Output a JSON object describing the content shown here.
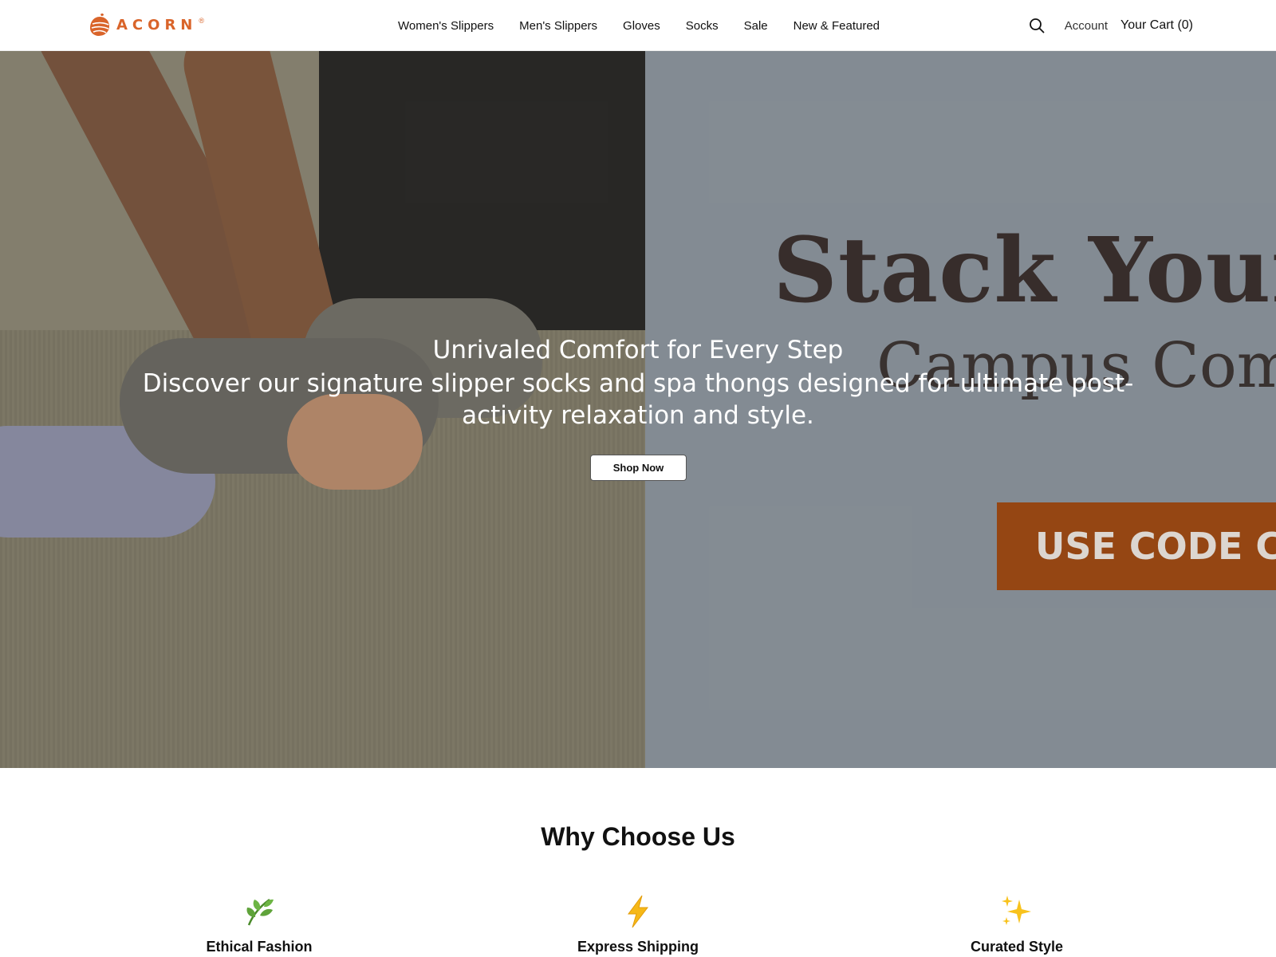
{
  "brand": {
    "name": "ACORN",
    "registered": "®",
    "color": "#d9642a"
  },
  "nav": {
    "items": [
      {
        "label": "Women's Slippers"
      },
      {
        "label": "Men's Slippers"
      },
      {
        "label": "Gloves"
      },
      {
        "label": "Socks"
      },
      {
        "label": "Sale"
      },
      {
        "label": "New & Featured"
      }
    ]
  },
  "header": {
    "search_icon": "search-icon",
    "account_label": "Account",
    "cart_label": "Your Cart (0)"
  },
  "hero": {
    "heading": "Unrivaled Comfort for Every Step",
    "subheading": "Discover our signature slipper socks and spa thongs designed for ultimate post-activity relaxation and style.",
    "cta_label": "Shop Now",
    "promo_image": {
      "title": "Stack Your",
      "subtitle": "Campus Comfo",
      "code_text": "USE CODE CA",
      "code_bg": "#9e4a15",
      "panel_bg": "#8b939b"
    }
  },
  "why": {
    "title": "Why Choose Us",
    "features": [
      {
        "icon": "🌿",
        "icon_name": "leaf-icon",
        "label": "Ethical Fashion"
      },
      {
        "icon": "⚡",
        "icon_name": "lightning-icon",
        "label": "Express Shipping"
      },
      {
        "icon": "✨",
        "icon_name": "sparkles-icon",
        "label": "Curated Style"
      }
    ]
  }
}
